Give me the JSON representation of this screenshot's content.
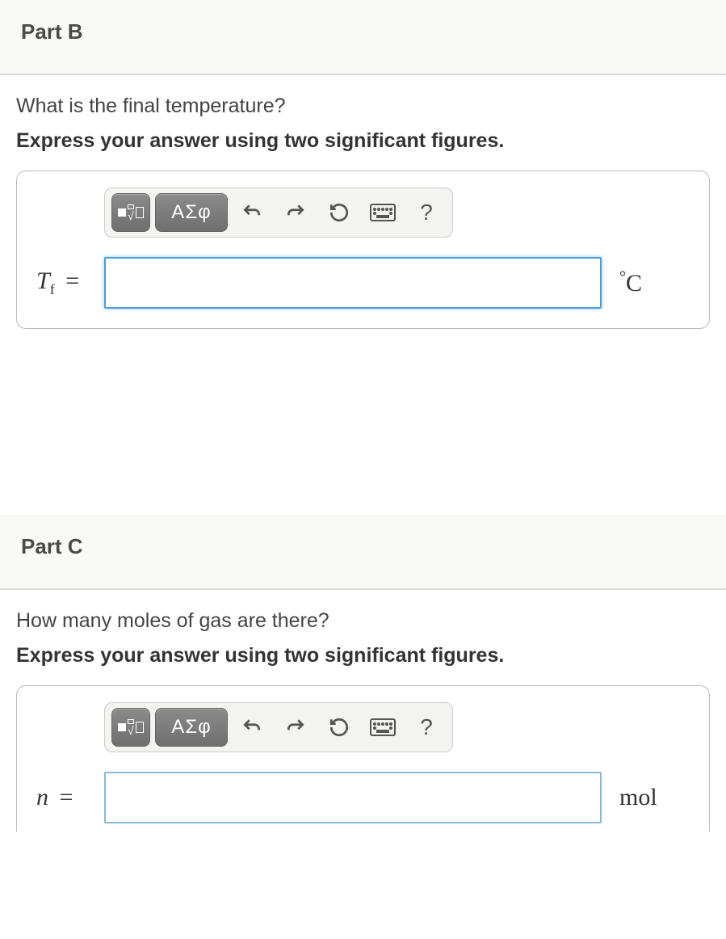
{
  "partB": {
    "title": "Part B",
    "question": "What is the final temperature?",
    "instruction": "Express your answer using two significant figures.",
    "toolbar": {
      "templates": "templates",
      "symbols": "ΑΣφ",
      "undo": "undo",
      "redo": "redo",
      "reset": "reset",
      "keyboard": "keyboard",
      "help": "?"
    },
    "variable_html": "T",
    "subscript": "f",
    "equals": " =",
    "input_value": "",
    "unit": "°C"
  },
  "partC": {
    "title": "Part C",
    "question": "How many moles of gas are there?",
    "instruction": "Express your answer using two significant figures.",
    "toolbar": {
      "templates": "templates",
      "symbols": "ΑΣφ",
      "undo": "undo",
      "redo": "redo",
      "reset": "reset",
      "keyboard": "keyboard",
      "help": "?"
    },
    "variable_html": "n",
    "equals": " =",
    "input_value": "",
    "unit": "mol"
  }
}
